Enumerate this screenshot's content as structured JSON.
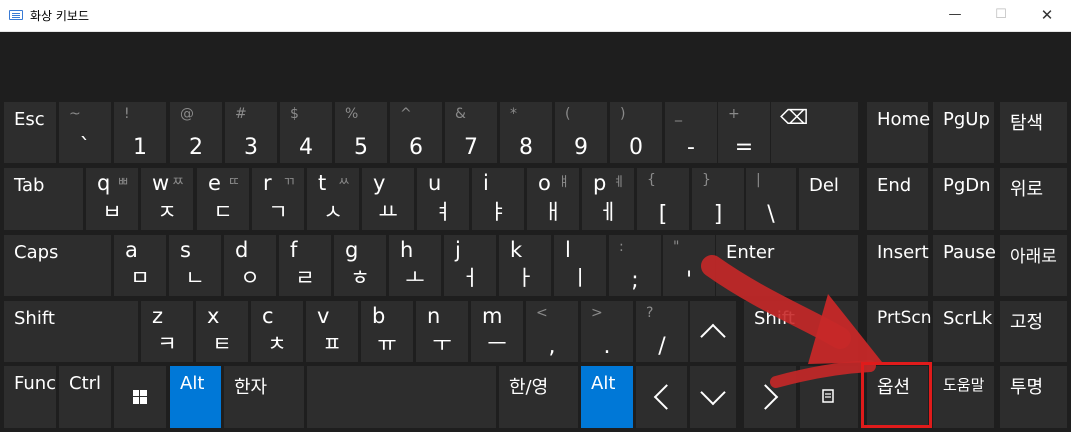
{
  "window": {
    "title": "화상 키보드",
    "min": "—",
    "max": "☐",
    "close": "✕"
  },
  "keys": {
    "esc": "Esc",
    "r1": [
      {
        "t": "~",
        "b": "`"
      },
      {
        "t": "!",
        "b": "1"
      },
      {
        "t": "@",
        "b": "2"
      },
      {
        "t": "#",
        "b": "3"
      },
      {
        "t": "$",
        "b": "4"
      },
      {
        "t": "%",
        "b": "5"
      },
      {
        "t": "^",
        "b": "6"
      },
      {
        "t": "&",
        "b": "7"
      },
      {
        "t": "*",
        "b": "8"
      },
      {
        "t": "(",
        "b": "9"
      },
      {
        "t": ")",
        "b": "0"
      },
      {
        "t": "_",
        "b": "-"
      },
      {
        "t": "+",
        "b": "="
      }
    ],
    "backspace": "⌫",
    "home": "Home",
    "pgup": "PgUp",
    "search": "탐색",
    "tab": "Tab",
    "r2": [
      {
        "l": "q",
        "t": "ㅃ",
        "b": "ㅂ"
      },
      {
        "l": "w",
        "t": "ㅉ",
        "b": "ㅈ"
      },
      {
        "l": "e",
        "t": "ㄸ",
        "b": "ㄷ"
      },
      {
        "l": "r",
        "t": "ㄲ",
        "b": "ㄱ"
      },
      {
        "l": "t",
        "t": "ㅆ",
        "b": "ㅅ"
      },
      {
        "l": "y",
        "t": "",
        "b": "ㅛ"
      },
      {
        "l": "u",
        "t": "",
        "b": "ㅕ"
      },
      {
        "l": "i",
        "t": "",
        "b": "ㅑ"
      },
      {
        "l": "o",
        "t": "ㅒ",
        "b": "ㅐ"
      },
      {
        "l": "p",
        "t": "ㅖ",
        "b": "ㅔ"
      },
      {
        "l": "",
        "t": "{",
        "b": "["
      },
      {
        "l": "",
        "t": "}",
        "b": "]"
      },
      {
        "l": "",
        "t": "|",
        "b": "\\"
      }
    ],
    "del": "Del",
    "end": "End",
    "pgdn": "PgDn",
    "up_kr": "위로",
    "caps": "Caps",
    "r3": [
      {
        "l": "a",
        "b": "ㅁ"
      },
      {
        "l": "s",
        "b": "ㄴ"
      },
      {
        "l": "d",
        "b": "ㅇ"
      },
      {
        "l": "f",
        "b": "ㄹ"
      },
      {
        "l": "g",
        "b": "ㅎ"
      },
      {
        "l": "h",
        "b": "ㅗ"
      },
      {
        "l": "j",
        "b": "ㅓ"
      },
      {
        "l": "k",
        "b": "ㅏ"
      },
      {
        "l": "l",
        "b": "ㅣ"
      },
      {
        "l": "",
        "t": ":",
        "b": ";"
      },
      {
        "l": "",
        "t": "\"",
        "b": "'"
      }
    ],
    "enter": "Enter",
    "insert": "Insert",
    "pause": "Pause",
    "down_kr": "아래로",
    "shift": "Shift",
    "r4": [
      {
        "l": "z",
        "b": "ㅋ"
      },
      {
        "l": "x",
        "b": "ㅌ"
      },
      {
        "l": "c",
        "b": "ㅊ"
      },
      {
        "l": "v",
        "b": "ㅍ"
      },
      {
        "l": "b",
        "b": "ㅠ"
      },
      {
        "l": "n",
        "b": "ㅜ"
      },
      {
        "l": "m",
        "b": "ㅡ"
      },
      {
        "l": "",
        "t": "<",
        "b": ","
      },
      {
        "l": "",
        "t": ">",
        "b": "."
      },
      {
        "l": "",
        "t": "?",
        "b": "/"
      }
    ],
    "shift_r": "Shift",
    "prtscn": "PrtScn",
    "scrlk": "ScrLk",
    "fix": "고정",
    "func": "Func",
    "ctrl": "Ctrl",
    "alt": "Alt",
    "hanja": "한자",
    "hanyeong": "한/영",
    "alt_r": "Alt",
    "options": "옵션",
    "help": "도움말",
    "fade": "투명"
  },
  "colors": {
    "accent": "#0078d7",
    "key": "#2d2d2d",
    "bg": "#1e1e1e",
    "highlight": "#e01b1b",
    "annotation_arrow": "#c62828"
  }
}
